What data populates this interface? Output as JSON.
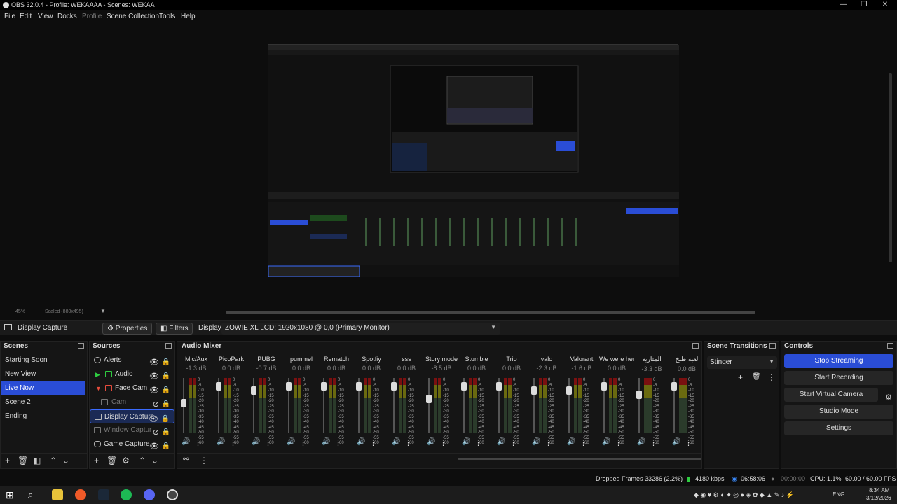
{
  "window": {
    "title": "OBS 32.0.4 - Profile: WEKAAAA - Scenes: WEKAA",
    "min": "—",
    "max": "❐",
    "close": "✕"
  },
  "menu": [
    "File",
    "Edit",
    "View",
    "Docks",
    "Profile",
    "Scene Collection",
    "Tools",
    "Help"
  ],
  "preview": {
    "zoom": "45%",
    "scale_label": "Scaled (880x495)"
  },
  "context": {
    "source": "Display Capture",
    "properties": "Properties",
    "filters": "Filters",
    "display_label": "Display",
    "display_value": "ZOWIE XL LCD: 1920x1080 @ 0,0 (Primary Monitor)"
  },
  "scenes": {
    "title": "Scenes",
    "items": [
      "Starting Soon",
      "New View",
      "Live Now",
      "Scene 2",
      "Ending"
    ],
    "selected": 2
  },
  "sources": {
    "title": "Sources",
    "items": [
      {
        "label": "Alerts",
        "type": "browser-icon",
        "indent": 0,
        "hidden": false
      },
      {
        "label": "Audio",
        "type": "group-icon",
        "indent": 1,
        "hidden": false,
        "green": true
      },
      {
        "label": "Face Cam",
        "type": "group-icon",
        "indent": 1,
        "hidden": false,
        "red": true
      },
      {
        "label": "Cam",
        "type": "camera-icon",
        "indent": 2,
        "hidden": true
      },
      {
        "label": "Display Capture",
        "type": "monitor-icon",
        "indent": 0,
        "hidden": false,
        "selected": true
      },
      {
        "label": "Window Captur",
        "type": "window-icon",
        "indent": 0,
        "hidden": true
      },
      {
        "label": "Game Capture",
        "type": "gamepad-icon",
        "indent": 0,
        "hidden": false
      }
    ]
  },
  "mixer": {
    "title": "Audio Mixer",
    "channels": [
      {
        "name": "Mic/Aux",
        "db": "-1.3 dB",
        "level": 0.5
      },
      {
        "name": "PicoPark",
        "db": "0.0 dB",
        "level": 0.9
      },
      {
        "name": "PUBG",
        "db": "-0.7 dB",
        "level": 0.8
      },
      {
        "name": "pummel",
        "db": "0.0 dB",
        "level": 0.9
      },
      {
        "name": "Rematch",
        "db": "0.0 dB",
        "level": 0.9
      },
      {
        "name": "Spotfiy",
        "db": "0.0 dB",
        "level": 0.9
      },
      {
        "name": "sss",
        "db": "0.0 dB",
        "level": 0.9
      },
      {
        "name": "Story mode",
        "db": "-8.5 dB",
        "level": 0.6
      },
      {
        "name": "Stumble",
        "db": "0.0 dB",
        "level": 0.9
      },
      {
        "name": "Trio",
        "db": "0.0 dB",
        "level": 0.9
      },
      {
        "name": "valo",
        "db": "-2.3 dB",
        "level": 0.8
      },
      {
        "name": "Valorant",
        "db": "-1.6 dB",
        "level": 0.8
      },
      {
        "name": "We were here",
        "db": "0.0 dB",
        "level": 0.9
      },
      {
        "name": "المتاريه",
        "db": "-3.3 dB",
        "level": 0.7
      },
      {
        "name": "لعبه طبخ",
        "db": "0.0 dB",
        "level": 0.9
      }
    ],
    "scale": [
      "0",
      "-5",
      "-10",
      "-15",
      "-20",
      "-25",
      "-30",
      "-35",
      "-40",
      "-45",
      "-50",
      "-55",
      "-60"
    ]
  },
  "transitions": {
    "title": "Scene Transitions",
    "value": "Stinger"
  },
  "controls": {
    "title": "Controls",
    "buttons": [
      "Stop Streaming",
      "Start Recording",
      "Start Virtual Camera",
      "Studio Mode",
      "Settings"
    ]
  },
  "status": {
    "dropped": "Dropped Frames 33286 (2.2%)",
    "bitrate": "4180 kbps",
    "stream_time": "06:58:06",
    "rec_time": "00:00:00",
    "cpu": "CPU: 1.1%",
    "fps": "60.00 / 60.00 FPS"
  },
  "taskbar": {
    "lang": "ENG",
    "time": "8:34 AM",
    "date": "3/12/2026"
  }
}
